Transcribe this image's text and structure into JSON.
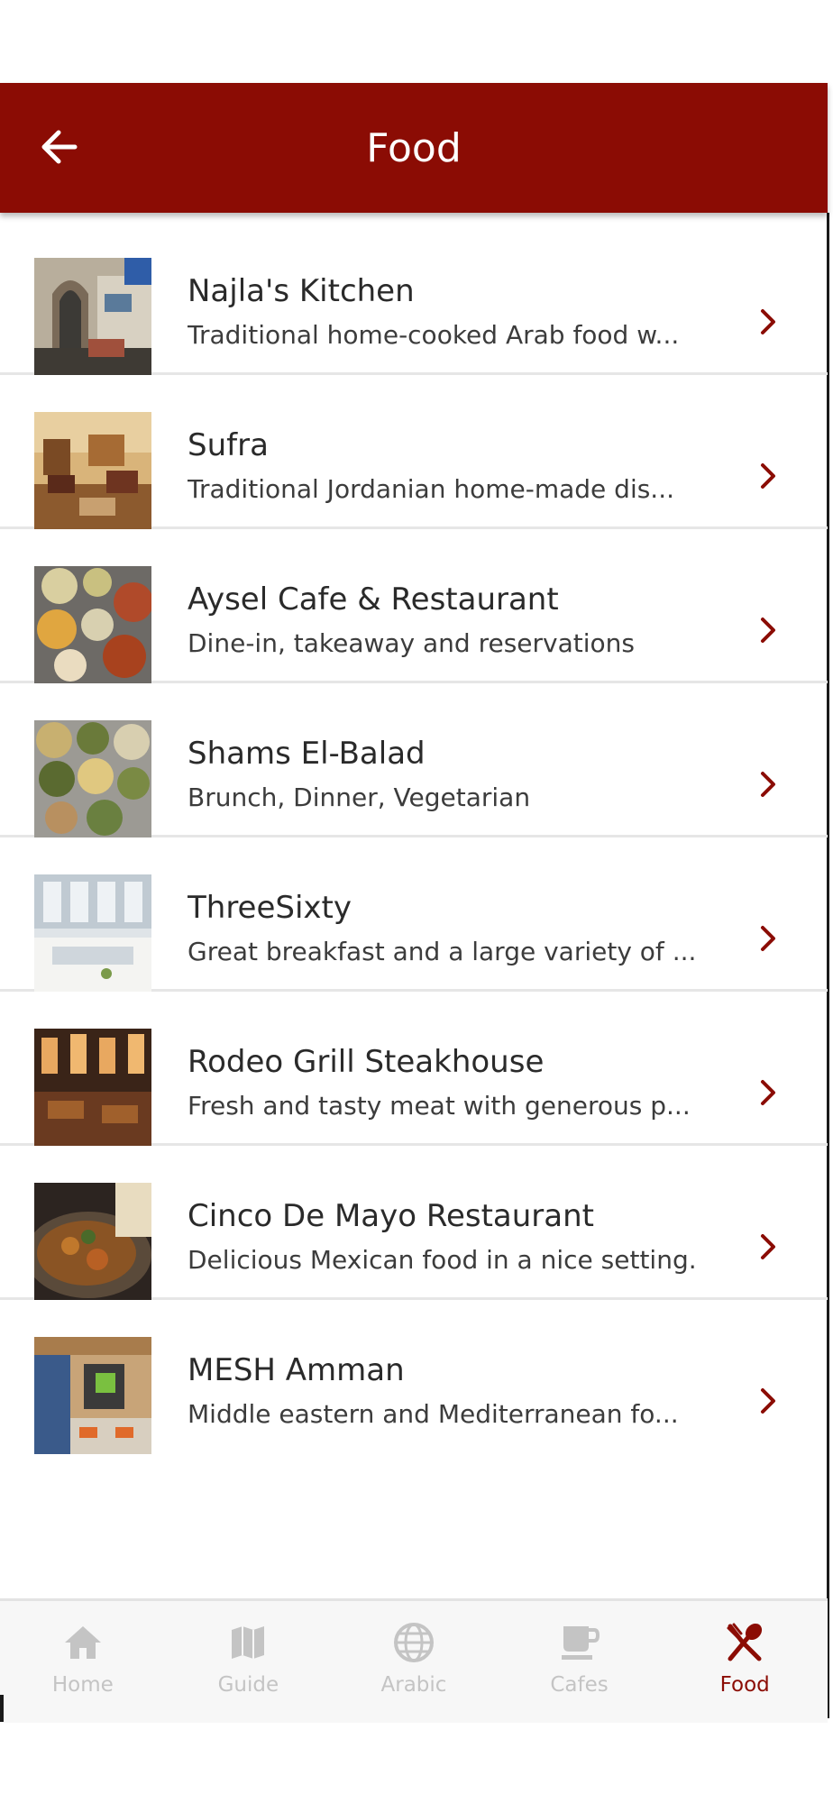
{
  "header": {
    "title": "Food",
    "back_icon": "arrow-left-icon"
  },
  "restaurants": [
    {
      "name": "Najla's Kitchen",
      "description": "Traditional home-cooked Arab food w..."
    },
    {
      "name": "Sufra",
      "description": "Traditional Jordanian home-made dis..."
    },
    {
      "name": "Aysel Cafe & Restaurant",
      "description": "Dine-in, takeaway and reservations"
    },
    {
      "name": "Shams El-Balad",
      "description": "Brunch, Dinner, Vegetarian"
    },
    {
      "name": "ThreeSixty",
      "description": "Great breakfast and a large variety of ..."
    },
    {
      "name": "Rodeo Grill Steakhouse",
      "description": "Fresh and tasty meat with generous p..."
    },
    {
      "name": "Cinco De Mayo Restaurant",
      "description": "Delicious Mexican food in a nice setting."
    },
    {
      "name": "MESH Amman",
      "description": "Middle eastern and Mediterranean fo..."
    }
  ],
  "bottom_nav": [
    {
      "label": "Home",
      "icon": "home-icon",
      "active": false
    },
    {
      "label": "Guide",
      "icon": "map-icon",
      "active": false
    },
    {
      "label": "Arabic",
      "icon": "globe-icon",
      "active": false
    },
    {
      "label": "Cafes",
      "icon": "coffee-cup-icon",
      "active": false
    },
    {
      "label": "Food",
      "icon": "fork-spoon-icon",
      "active": true
    }
  ],
  "colors": {
    "primary": "#8b0c04",
    "nav_inactive": "#c4c4c4",
    "title_text": "#2a2a2a",
    "description_text": "#3c3c3c",
    "divider": "#e6e6e6"
  }
}
